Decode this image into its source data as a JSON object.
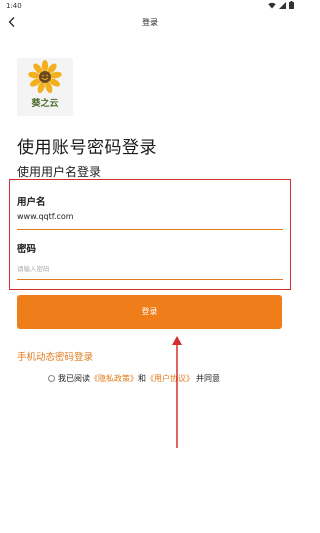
{
  "status_bar": {
    "time": "1:40"
  },
  "nav": {
    "title": "登录"
  },
  "logo": {
    "caption": "葵之云"
  },
  "page": {
    "title": "使用账号密码登录",
    "subtitle": "使用用户名登录"
  },
  "form": {
    "username_label": "用户名",
    "username_value": "www.qqtf.com",
    "password_label": "密码",
    "password_placeholder": "请输入密码"
  },
  "login_button": "登录",
  "sms_login_link": "手机动态密码登录",
  "agreement": {
    "prefix": "我已阅读",
    "privacy_link": "《隐私政策》",
    "and": "和",
    "user_link": "《用户协议》",
    "suffix": "并同意"
  },
  "colors": {
    "accent": "#ef7d1a",
    "highlight_box": "#d32f2f"
  }
}
